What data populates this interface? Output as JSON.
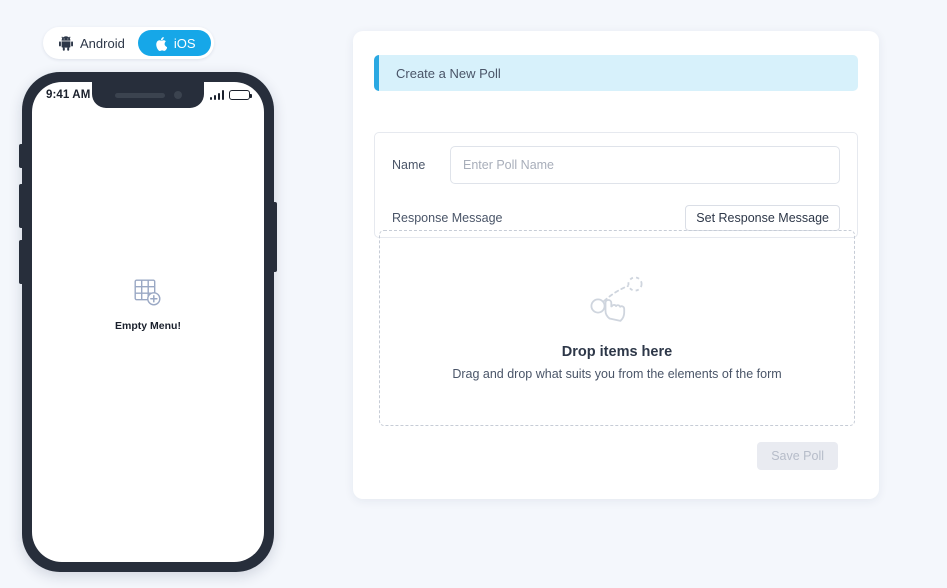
{
  "platform_toggle": {
    "options": [
      {
        "label": "Android",
        "icon": "android-icon",
        "active": false
      },
      {
        "label": "iOS",
        "icon": "apple-icon",
        "active": true
      }
    ],
    "active_color": "#16a7e8"
  },
  "phone_preview": {
    "status_bar": {
      "time": "9:41 AM",
      "signal_icon": "signal-bars-icon",
      "battery_icon": "battery-icon"
    },
    "empty_state": {
      "icon": "grid-add-icon",
      "label": "Empty Menu!"
    }
  },
  "poll_card": {
    "banner": {
      "title": "Create a New Poll",
      "background": "#d7f1fb",
      "accent": "#2aa8e2"
    },
    "form": {
      "name_label": "Name",
      "name_value": "",
      "name_placeholder": "Enter Poll Name",
      "response_label": "Response Message",
      "set_response_button": "Set Response Message"
    },
    "dropzone": {
      "icon": "drag-drop-hand-icon",
      "title": "Drop items here",
      "subtitle": "Drag and drop what suits you from the elements of the form"
    },
    "save_button": {
      "label": "Save Poll",
      "disabled": true
    }
  }
}
